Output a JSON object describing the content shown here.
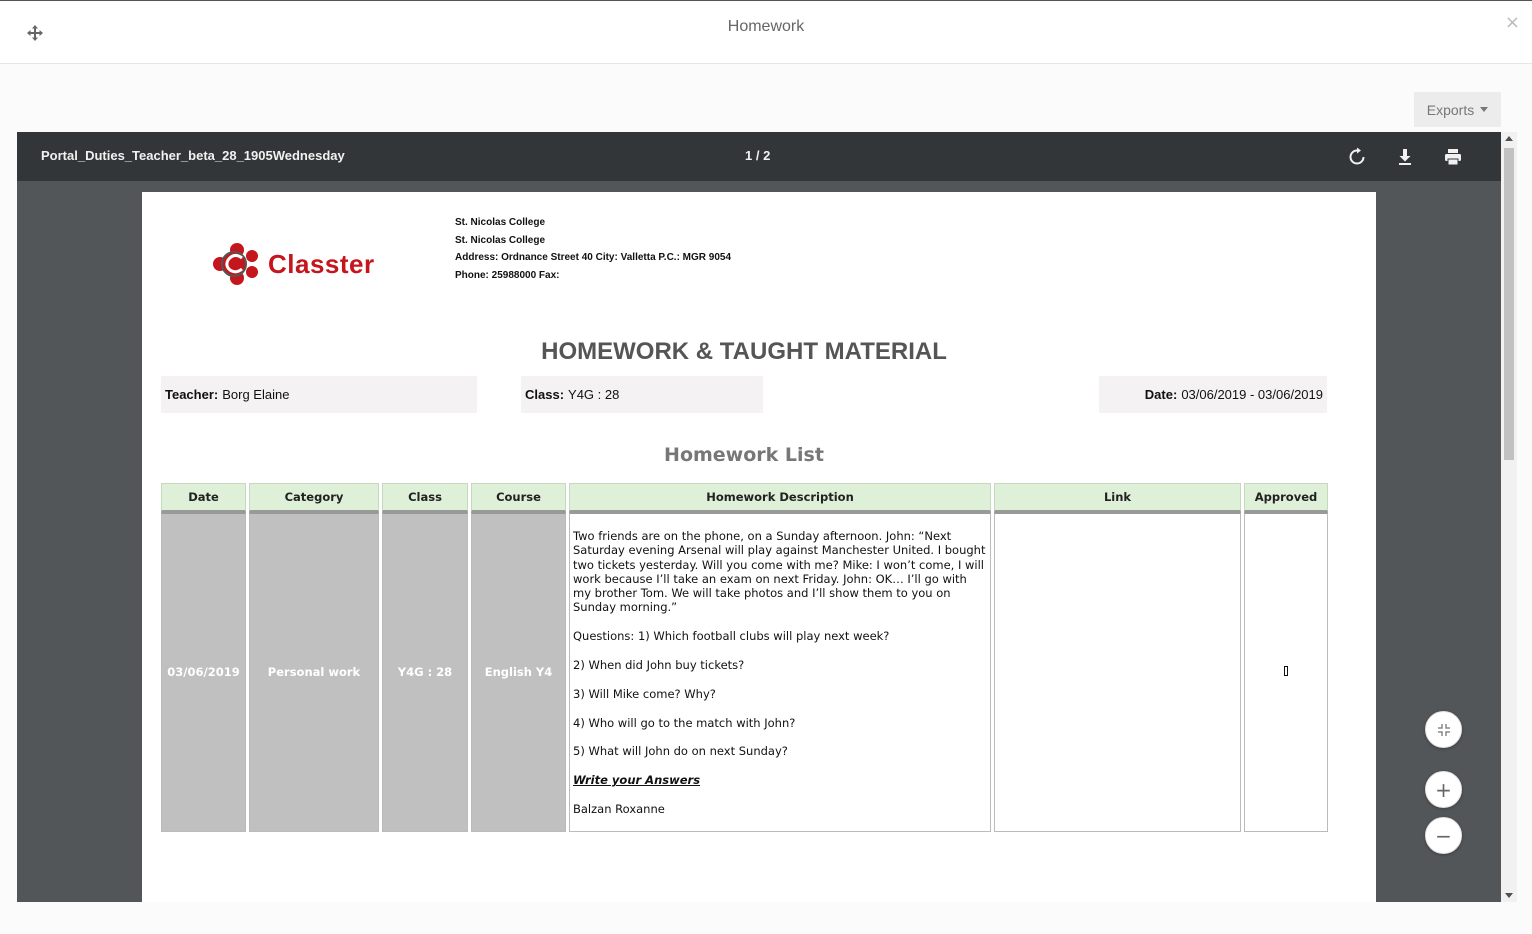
{
  "modal": {
    "title": "Homework",
    "close_label": "×"
  },
  "exports": {
    "label": "Exports"
  },
  "viewer": {
    "doc_name": "Portal_Duties_Teacher_beta_28_1905Wednesday",
    "page_count": "1 / 2"
  },
  "document": {
    "logo_text": "Classter",
    "school_info": [
      "St. Nicolas College",
      "St. Nicolas College",
      "Address: Ordnance Street 40 City: Valletta P.C.: MGR 9054",
      "Phone: 25988000 Fax:"
    ],
    "title": "HOMEWORK & TAUGHT MATERIAL",
    "teacher_label": "Teacher:",
    "teacher_value": "Borg Elaine",
    "class_label": "Class:",
    "class_value": "Y4G : 28",
    "date_label": "Date:",
    "date_value": "03/06/2019 - 03/06/2019",
    "list_title": "Homework List",
    "columns": [
      "Date",
      "Category",
      "Class",
      "Course",
      "Homework Description",
      "Link",
      "Approved"
    ],
    "row": {
      "date": "03/06/2019",
      "category": "Personal work",
      "class": "Y4G : 28",
      "course": "English Y4",
      "description": [
        "Two friends are on the phone, on a Sunday afternoon. John: “Next Saturday evening Arsenal will play against Manchester United. I bought two tickets yesterday. Will you come with me? Mike: I won’t come, I will work because I’ll take an exam on next Friday. John: OK… I’ll go with my brother Tom. We will take photos and I’ll show them to you on Sunday morning.”",
        "Questions: 1) Which football clubs will play next week?",
        "2) When did John buy tickets?",
        "3) Will Mike come? Why?",
        "4) Who will go to the match with John?",
        "5) What will John do on next Sunday?"
      ],
      "answers_label": "Write your Answers",
      "author": "Balzan Roxanne",
      "link": ""
    }
  },
  "controls": {
    "zoom_in": "+",
    "zoom_out": "−"
  }
}
